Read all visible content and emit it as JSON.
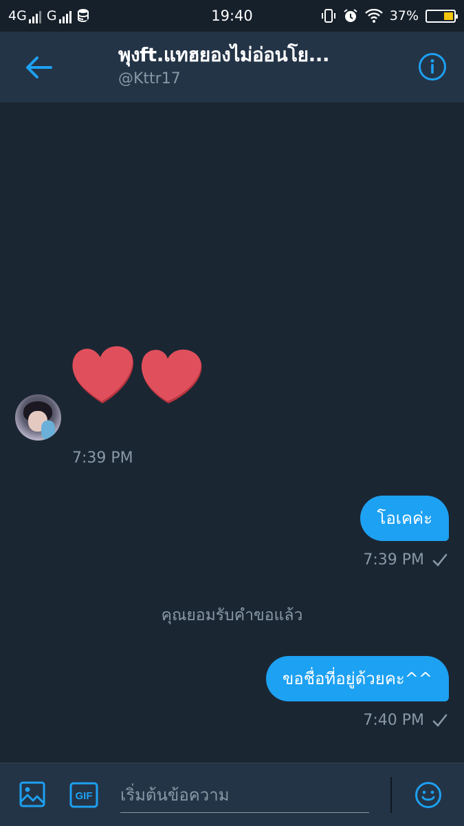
{
  "status_bar": {
    "network_1": "4G",
    "network_2": "G",
    "time": "19:40",
    "battery_text": "37%",
    "battery_level": 0.37,
    "battery_color": "#f5c60b"
  },
  "header": {
    "title": "พุงft.แทฮยองไม่อ่อนโย...",
    "handle": "@Kttr17",
    "back_icon": "arrow-left-icon",
    "info_icon": "info-icon"
  },
  "conversation": {
    "incoming": {
      "content": "two red hearts",
      "timestamp": "7:39 PM"
    },
    "outgoing": [
      {
        "text": "โอเคค่ะ",
        "timestamp": "7:39 PM",
        "status_icon": "checkmark-icon"
      },
      {
        "text": "ขอชื่อที่อยู่ด้วยคะ^^",
        "timestamp": "7:40 PM",
        "status_icon": "checkmark-icon"
      }
    ],
    "system_note": "คุณยอมรับคำขอแล้ว"
  },
  "composer": {
    "placeholder": "เริ่มต้นข้อความ",
    "gif_label": "GIF",
    "media_icon": "image-icon",
    "emoji_icon": "smiley-icon"
  },
  "colors": {
    "accent": "#1da1f2",
    "background": "#1b2633",
    "header_bg": "#243447",
    "muted_text": "#8899a6",
    "heart": "#e0505c"
  }
}
